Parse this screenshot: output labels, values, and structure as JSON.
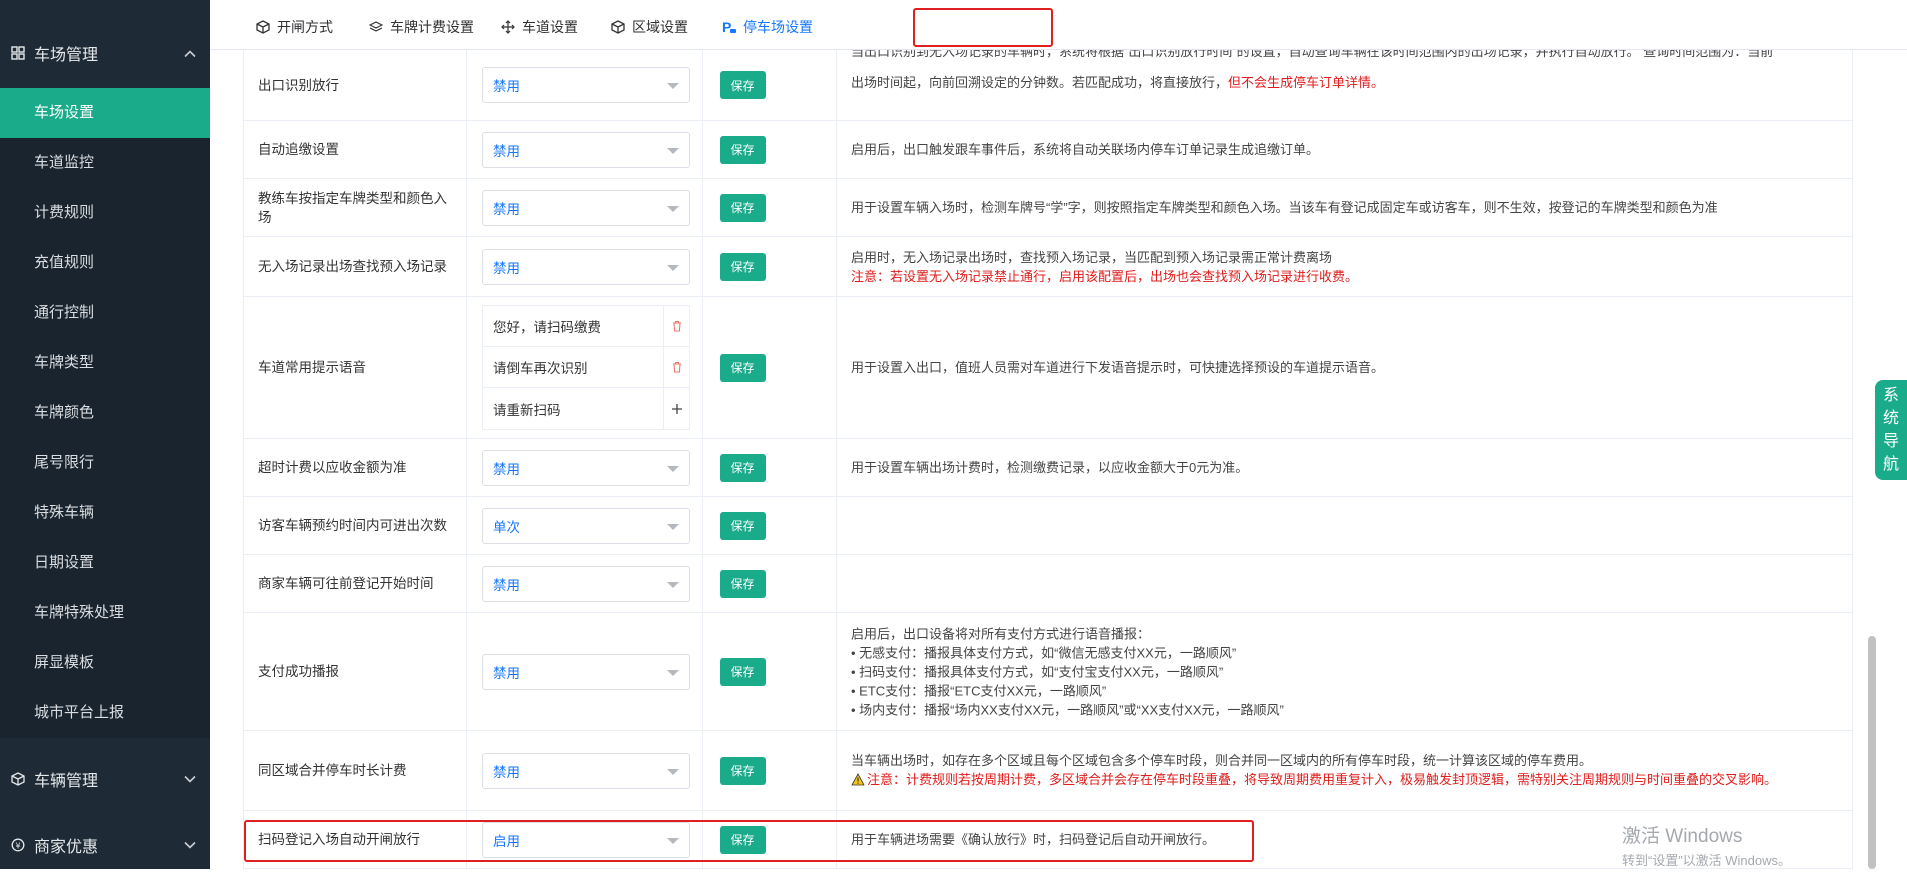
{
  "sidebar": {
    "group_parking": "车场管理",
    "items": [
      {
        "label": "车场设置"
      },
      {
        "label": "车道监控"
      },
      {
        "label": "计费规则"
      },
      {
        "label": "充值规则"
      },
      {
        "label": "通行控制"
      },
      {
        "label": "车牌类型"
      },
      {
        "label": "车牌颜色"
      },
      {
        "label": "尾号限行"
      },
      {
        "label": "特殊车辆"
      },
      {
        "label": "日期设置"
      },
      {
        "label": "车牌特殊处理"
      },
      {
        "label": "屏显模板"
      },
      {
        "label": "城市平台上报"
      }
    ],
    "group_vehicle": "车辆管理",
    "group_merchant": "商家优惠"
  },
  "tabs": [
    {
      "label": "开闸方式"
    },
    {
      "label": "车牌计费设置"
    },
    {
      "label": "车道设置"
    },
    {
      "label": "区域设置"
    },
    {
      "label": "停车场设置"
    }
  ],
  "save_label": "保存",
  "rows": [
    {
      "name": "出口识别放行",
      "value": "禁用",
      "desc_top": "当出口识别到无入场记录的车辆时，系统将根据“出口识别放行时间”的设置，自动查询车辆在该时间范围内的出场记录，并执行自动放行。 查询时间范围为：当前",
      "desc": "出场时间起，向前回溯设定的分钟数。若匹配成功，将直接放行，",
      "desc_red": "但不会生成停车订单详情。"
    },
    {
      "name": "自动追缴设置",
      "value": "禁用",
      "desc": "启用后，出口触发跟车事件后，系统将自动关联场内停车订单记录生成追缴订单。"
    },
    {
      "name": "教练车按指定车牌类型和颜色入场",
      "value": "禁用",
      "desc": "用于设置车辆入场时，检测车牌号“学”字，则按照指定车牌类型和颜色入场。当该车有登记成固定车或访客车，则不生效，按登记的车牌类型和颜色为准"
    },
    {
      "name": "无入场记录出场查找预入场记录",
      "value": "禁用",
      "desc": "启用时，无入场记录出场时，查找预入场记录，当匹配到预入场记录需正常计费离场",
      "desc_red": "注意：若设置无入场记录禁止通行，启用该配置后，出场也会查找预入场记录进行收费。"
    },
    {
      "name": "车道常用提示语音",
      "voices": [
        "您好，请扫码缴费",
        "请倒车再次识别",
        "请重新扫码"
      ],
      "desc": "用于设置入出口，值班人员需对车道进行下发语音提示时，可快捷选择预设的车道提示语音。"
    },
    {
      "name": "超时计费以应收金额为准",
      "value": "禁用",
      "desc": "用于设置车辆出场计费时，检测缴费记录，以应收金额大于0元为准。"
    },
    {
      "name": "访客车辆预约时间内可进出次数",
      "value": "单次"
    },
    {
      "name": "商家车辆可往前登记开始时间",
      "value": "禁用"
    },
    {
      "name": "支付成功播报",
      "value": "禁用",
      "desc_lines": [
        "启用后，出口设备将对所有支付方式进行语音播报：",
        "• 无感支付：播报具体支付方式，如“微信无感支付XX元，一路顺风”",
        "• 扫码支付：播报具体支付方式，如“支付宝支付XX元，一路顺风”",
        "• ETC支付：播报“ETC支付XX元，一路顺风”",
        "• 场内支付：播报“场内XX支付XX元，一路顺风”或“XX支付XX元，一路顺风”"
      ]
    },
    {
      "name": "同区域合并停车时长计费",
      "value": "禁用",
      "desc": "当车辆出场时，如存在多个区域且每个区域包含多个停车时段，则合并同一区域内的所有停车时段，统一计算该区域的停车费用。",
      "desc_red": "注意：计费规则若按周期计费，多区域合并会存在停车时段重叠，将导致周期费用重复计入，极易触发封顶逻辑，需特别关注周期规则与时间重叠的交叉影响。"
    },
    {
      "name": "扫码登记入场自动开闸放行",
      "value": "启用",
      "desc": "用于车辆进场需要《确认放行》时，扫码登记后自动开闸放行。"
    }
  ],
  "side_nav": [
    "系",
    "统",
    "导",
    "航"
  ],
  "watermark": {
    "line1": "激活 Windows",
    "line2": "转到“设置”以激活 Windows。"
  },
  "colors": {
    "accent": "#1aab8b",
    "sidebar_bg": "#1e2a35",
    "tab_active": "#1677ff",
    "warning_red": "#e01c1c",
    "highlight_box": "#e02020"
  }
}
